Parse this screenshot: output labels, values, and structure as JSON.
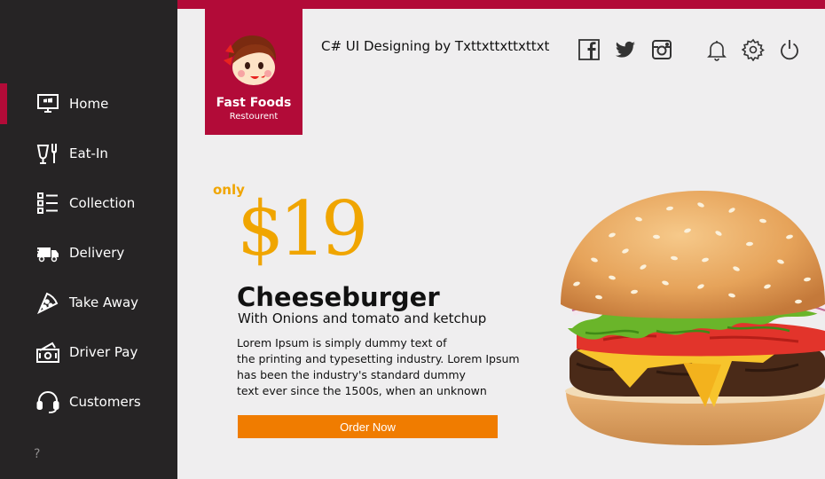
{
  "window": {
    "title": "C# UI Designing by Txttxttxttxttxt"
  },
  "brand": {
    "name": "Fast Foods",
    "tagline": "Restourent",
    "color": "#b20b38"
  },
  "sidebar": {
    "items": [
      {
        "label": "Home",
        "icon": "monitor-icon",
        "active": true
      },
      {
        "label": "Eat-In",
        "icon": "dining-icon",
        "active": false
      },
      {
        "label": "Collection",
        "icon": "checklist-icon",
        "active": false
      },
      {
        "label": "Delivery",
        "icon": "truck-icon",
        "active": false
      },
      {
        "label": "Take Away",
        "icon": "pizza-icon",
        "active": false
      },
      {
        "label": "Driver Pay",
        "icon": "money-icon",
        "active": false
      },
      {
        "label": "Customers",
        "icon": "headset-icon",
        "active": false
      }
    ],
    "help": "?"
  },
  "toolbar": {
    "social": [
      "facebook-icon",
      "twitter-icon",
      "instagram-icon"
    ],
    "actions": [
      "bell-icon",
      "gear-icon",
      "power-icon"
    ]
  },
  "promo": {
    "only": "only",
    "price": "$19",
    "title": "Cheeseburger",
    "subtitle": "With Onions and tomato and ketchup",
    "description": "Lorem Ipsum is simply dummy text of\nthe printing and typesetting industry. Lorem Ipsum\n has been the industry's standard dummy\ntext ever since the 1500s, when an unknown",
    "order_label": "Order Now",
    "accent_color": "#f0a500",
    "button_color": "#f07c00"
  }
}
